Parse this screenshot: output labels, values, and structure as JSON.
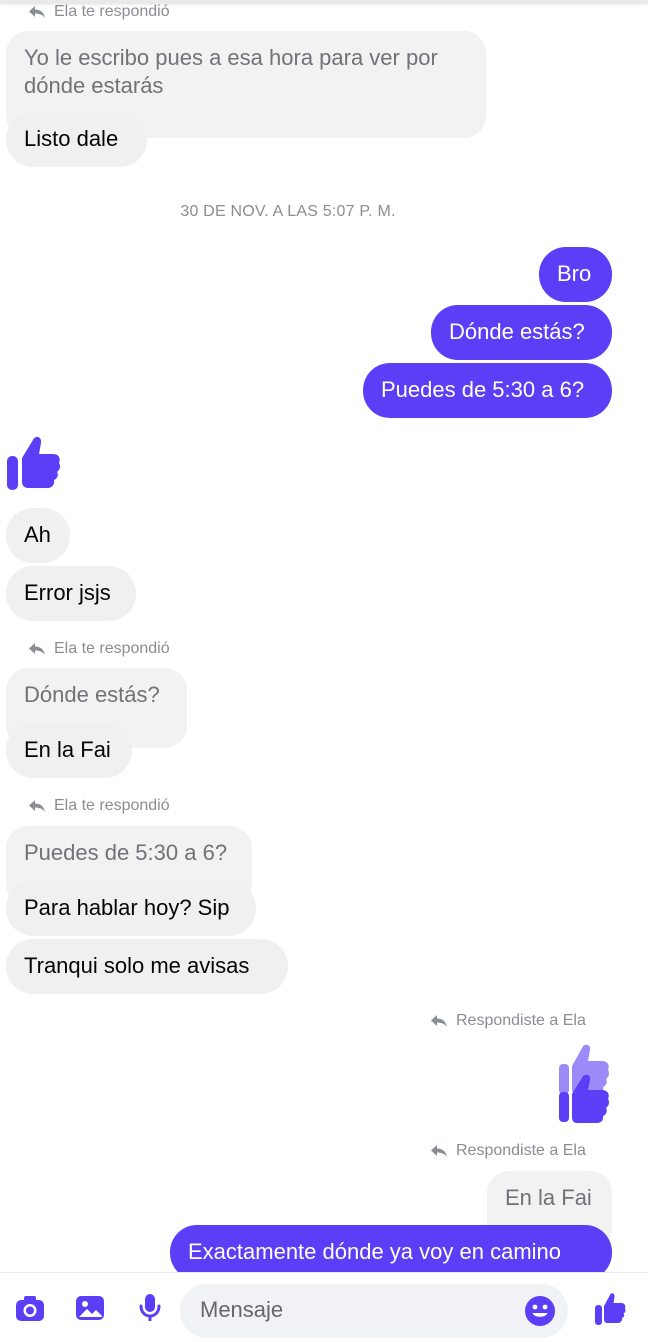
{
  "colors": {
    "accent": "#5b3ef5",
    "bubble_in": "#f0f0f0",
    "muted_text": "#8a8d91"
  },
  "messages": {
    "reply1": {
      "header": "Ela te respondió",
      "quoted": "Yo le escribo pues a esa hora para ver por dónde estarás",
      "quoted_line1": "Yo le escribo pues a esa hora para ver por",
      "quoted_line2": "dónde estarás",
      "reply": "Listo dale"
    },
    "timestamp": "30 DE NOV. A LAS 5:07 P. M.",
    "out1": "Bro",
    "out2": "Dónde estás?",
    "out3": "Puedes de 5:30 a 6?",
    "like_icon": "thumbs-up-icon",
    "in1": "Ah",
    "in2": "Error jsjs",
    "reply2": {
      "header": "Ela te respondió",
      "quoted": "Dónde estás?",
      "reply": "En la Fai"
    },
    "reply3": {
      "header": "Ela te respondió",
      "quoted": "Puedes de 5:30 a 6?",
      "reply": "Para hablar hoy? Sip"
    },
    "in3": "Tranqui solo me avisas",
    "reply4": {
      "header": "Respondiste a Ela",
      "quoted_icon": "thumbs-up-icon"
    },
    "reply5": {
      "header": "Respondiste a Ela",
      "quoted": "En la Fai",
      "reply": "Exactamente dónde ya voy en camino"
    }
  },
  "composer": {
    "placeholder": "Mensaje",
    "icons": [
      "camera-icon",
      "image-icon",
      "microphone-icon",
      "emoji-icon",
      "thumbs-up-icon"
    ]
  }
}
